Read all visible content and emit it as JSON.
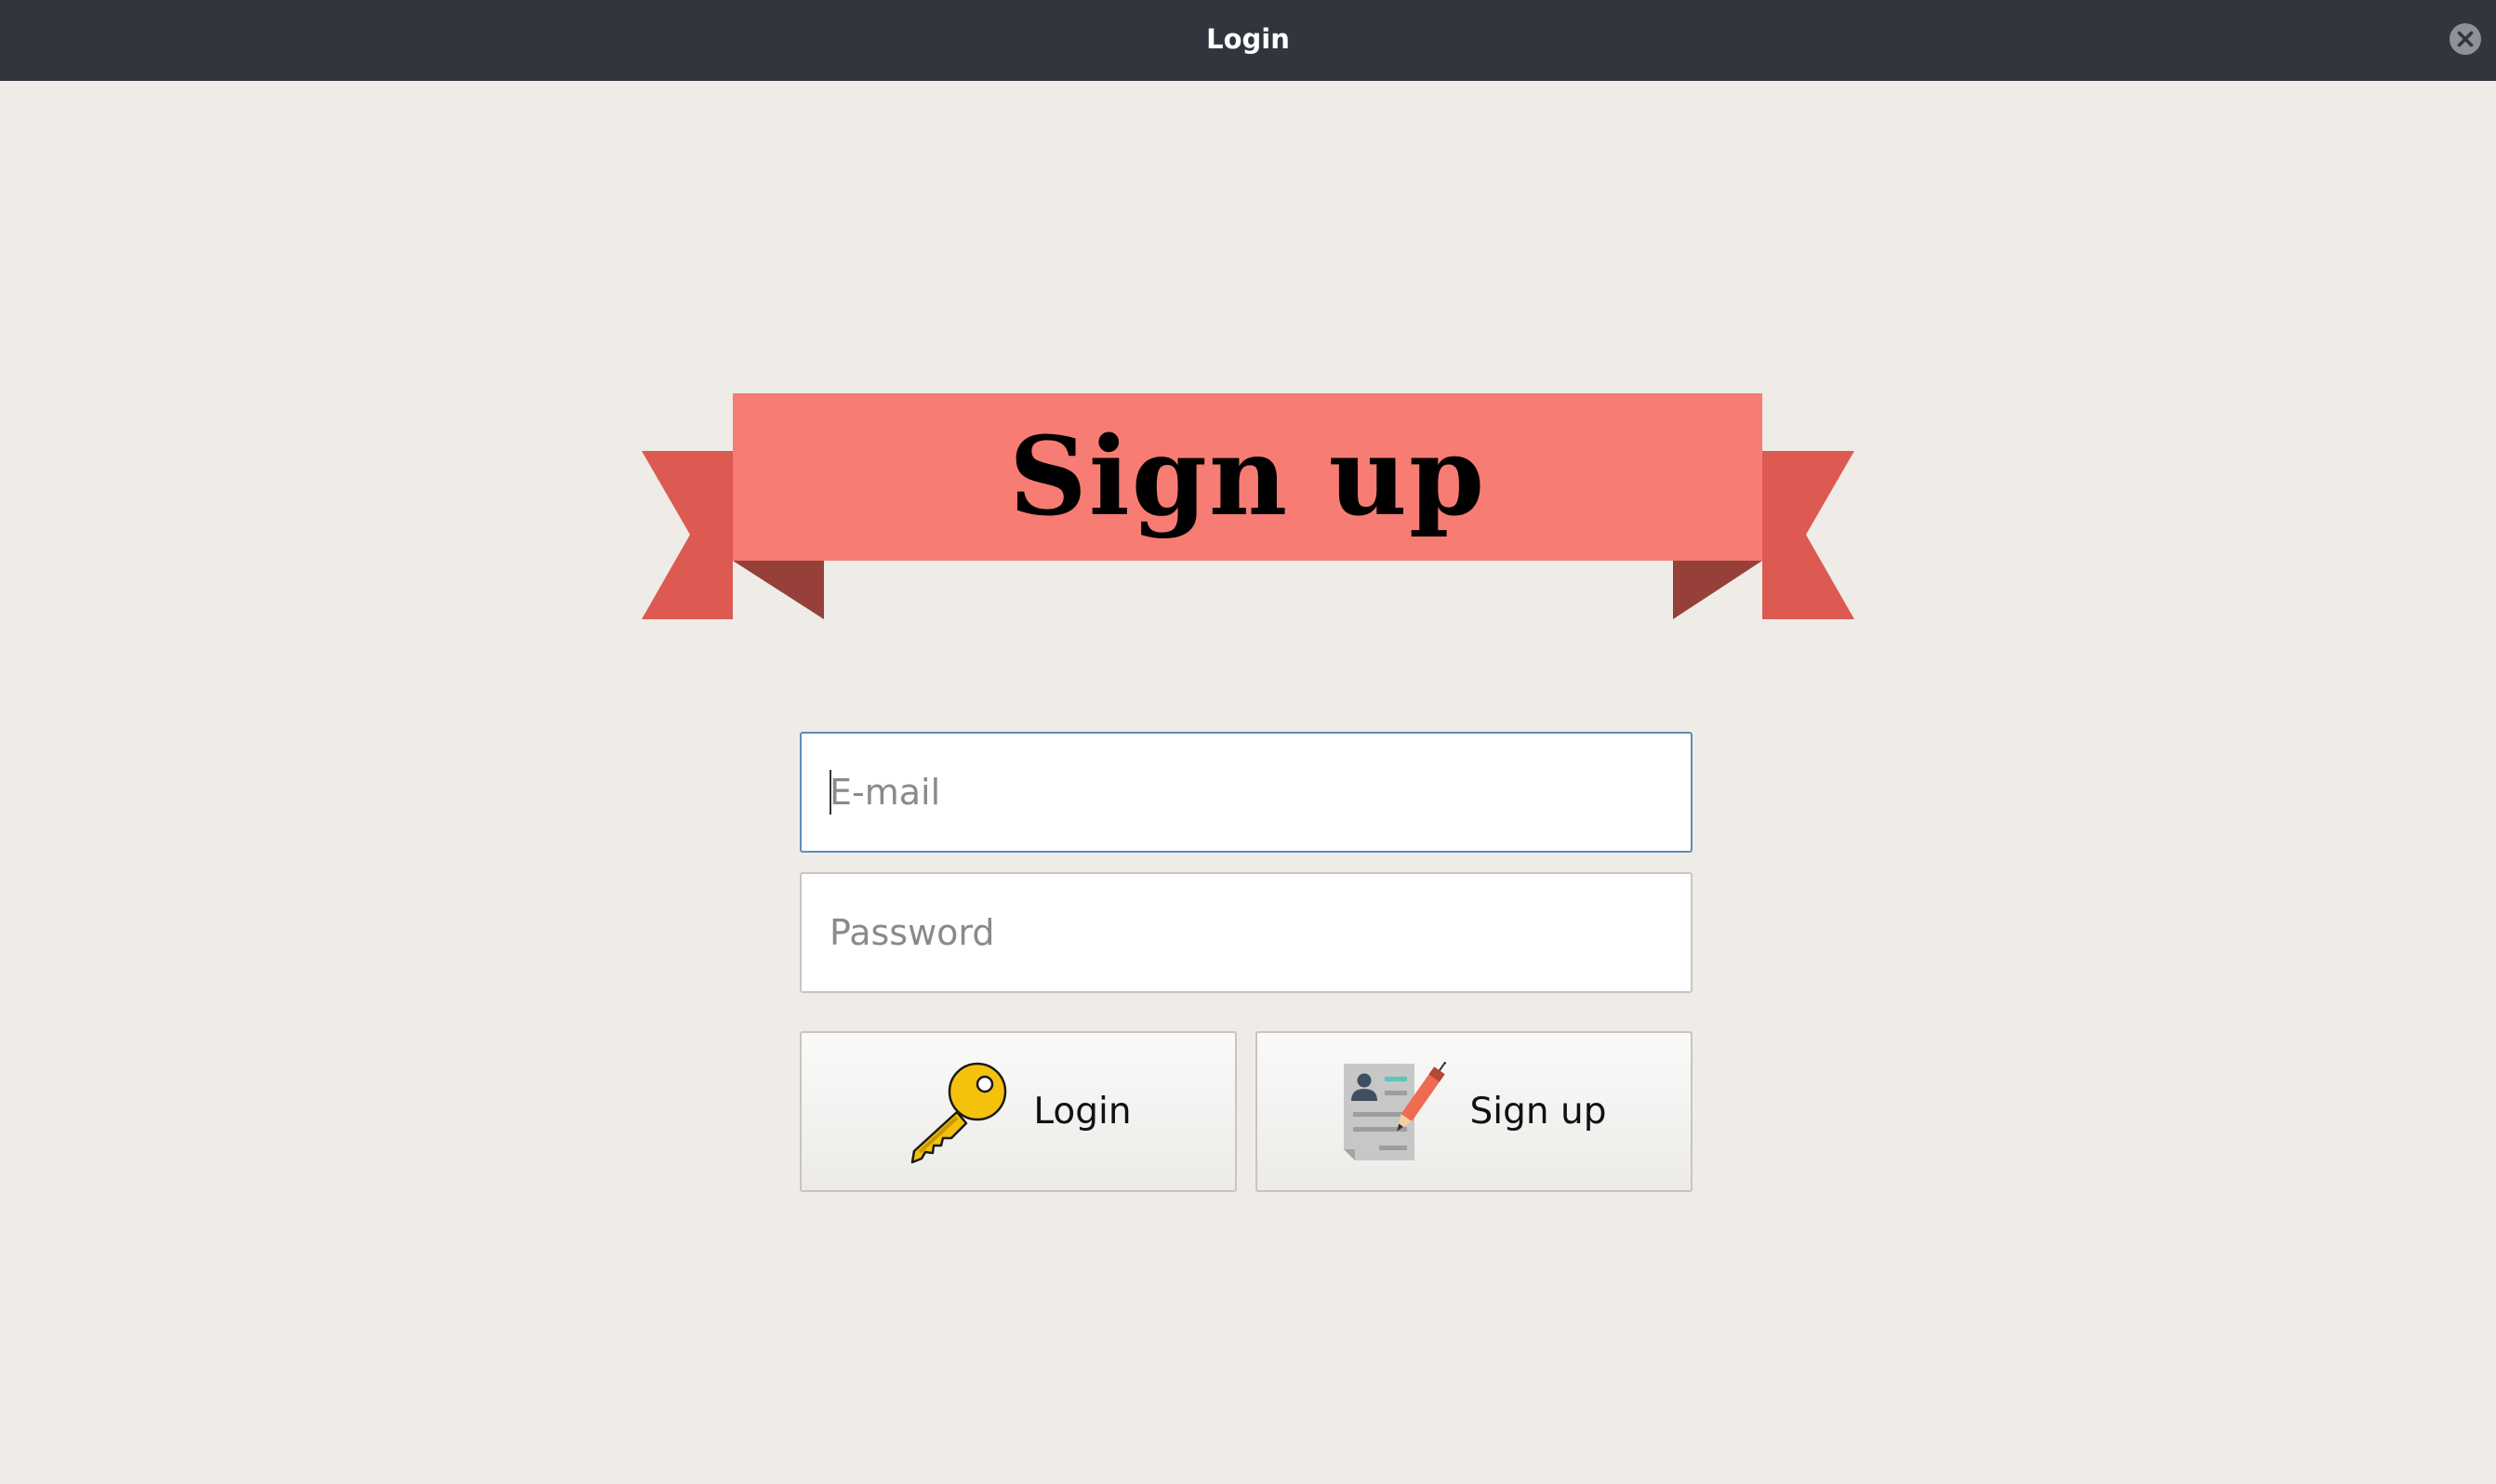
{
  "window": {
    "title": "Login",
    "close_icon": "close-icon"
  },
  "banner": {
    "title": "Sign up",
    "colors": {
      "front": "#f77c74",
      "tails": "#dc5a52",
      "folds": "#973f39"
    }
  },
  "form": {
    "email": {
      "placeholder": "E-mail",
      "value": ""
    },
    "password": {
      "placeholder": "Password",
      "value": ""
    }
  },
  "buttons": {
    "login": {
      "label": "Login",
      "icon": "key-icon"
    },
    "signup": {
      "label": "Sign up",
      "icon": "contract-pen-icon"
    }
  },
  "colors": {
    "background": "#efece7",
    "titlebar": "#31353d",
    "focus_border": "#5f8db9"
  }
}
